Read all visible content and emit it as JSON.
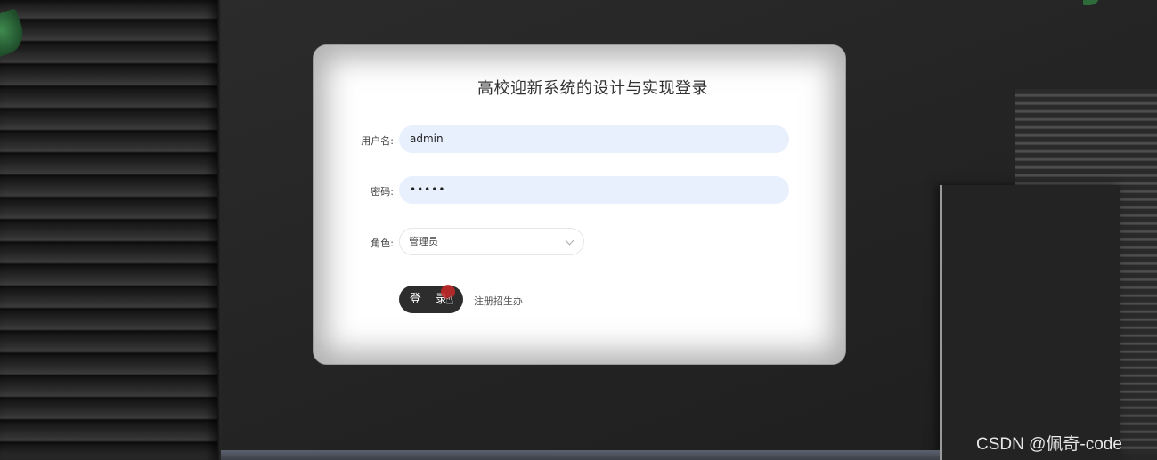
{
  "login": {
    "title": "高校迎新系统的设计与实现登录",
    "username_label": "用户名:",
    "username_value": "admin",
    "password_label": "密码:",
    "password_value": "•••••",
    "role_label": "角色:",
    "role_selected": "管理员",
    "login_button": "登 录",
    "register_link": "注册招生办"
  },
  "watermark": "CSDN @佩奇-code",
  "colors": {
    "input_bg": "#e8f0fe",
    "button_bg": "#2d2d2d",
    "background": "#262626"
  },
  "icons": {
    "select_arrow": "chevron-down-icon",
    "cursor": "hand-pointer-icon"
  }
}
